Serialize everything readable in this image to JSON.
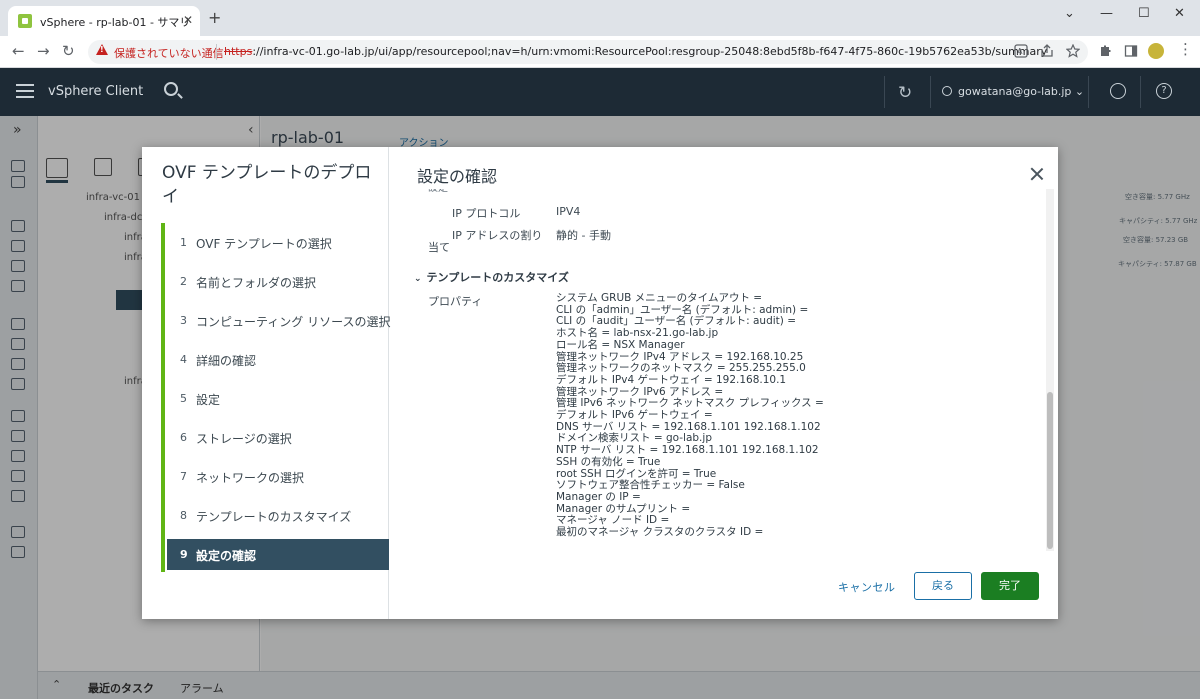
{
  "browser": {
    "tab_title": "vSphere - rp-lab-01 - サマリ",
    "tab_close": "✕",
    "new_tab": "+",
    "insecure_label": "保護されていない通信",
    "url_proto": "https",
    "url_rest": "://infra-vc-01.go-lab.jp/ui/app/resourcepool;nav=h/urn:vmomi:ResourcePool:resgroup-25048:8ebd5f8b-f647-4f75-860c-19b5762ea53b/summary",
    "back": "←",
    "forward": "→",
    "reload": "↻",
    "min": "—",
    "max": "☐",
    "close": "✕",
    "caret": "⌄"
  },
  "vsphere": {
    "brand": "vSphere Client",
    "user": "gowatana@go-lab.jp",
    "user_caret": "⌄",
    "help": "?",
    "refresh": "↻",
    "page_title": "rp-lab-01",
    "actions": "アクション",
    "expand": "»",
    "collapse": "‹",
    "tree": [
      "infra-vc-01",
      "infra-dc",
      "infra",
      "infra",
      "infra"
    ],
    "capacity": [
      "空き容量: 5.77 GHz",
      "キャパシティ: 5.77 GHz",
      "空き容量: 57.23 GB",
      "キャパシティ: 57.87 GB"
    ],
    "bottom_tabs": [
      "最近のタスク",
      "アラーム"
    ],
    "bottom_chev": "⌃"
  },
  "wizard": {
    "title": "OVF テンプレートのデプロイ",
    "steps": [
      {
        "num": "1",
        "label": "OVF テンプレートの選択"
      },
      {
        "num": "2",
        "label": "名前とフォルダの選択"
      },
      {
        "num": "3",
        "label": "コンピューティング リソースの選択"
      },
      {
        "num": "4",
        "label": "詳細の確認"
      },
      {
        "num": "5",
        "label": "設定"
      },
      {
        "num": "6",
        "label": "ストレージの選択"
      },
      {
        "num": "7",
        "label": "ネットワークの選択"
      },
      {
        "num": "8",
        "label": "テンプレートのカスタマイズ"
      },
      {
        "num": "9",
        "label": "設定の確認"
      }
    ],
    "active_step": 9,
    "heading": "設定の確認",
    "top_cut_label": "設定",
    "ip_protocol_label": "IP プロトコル",
    "ip_protocol_value": "IPV4",
    "ip_alloc_label": "IP アドレスの割り",
    "ip_alloc_label2": "当て",
    "ip_alloc_value": "静的 - 手動",
    "section_customize": "テンプレートのカスタマイズ",
    "section_chev": "⌄",
    "properties_label": "プロパティ",
    "properties": [
      "システム GRUB メニューのタイムアウト =",
      "CLI の「admin」ユーザー名 (デフォルト: admin) =",
      "CLI の「audit」ユーザー名 (デフォルト: audit) =",
      "ホスト名 = lab-nsx-21.go-lab.jp",
      "ロール名 = NSX Manager",
      "管理ネットワーク IPv4 アドレス = 192.168.10.25",
      "管理ネットワークのネットマスク = 255.255.255.0",
      "デフォルト IPv4 ゲートウェイ = 192.168.10.1",
      "管理ネットワーク IPv6 アドレス =",
      "管理 IPv6 ネットワーク ネットマスク プレフィックス =",
      "デフォルト IPv6 ゲートウェイ =",
      "DNS サーバ リスト = 192.168.1.101 192.168.1.102",
      "ドメイン検索リスト = go-lab.jp",
      "NTP サーバ リスト = 192.168.1.101 192.168.1.102",
      "SSH の有効化 = True",
      "root SSH ログインを許可 = True",
      "ソフトウェア整合性チェッカー = False",
      "Manager の IP =",
      "Manager のサムプリント =",
      "マネージャ ノード ID =",
      "最初のマネージャ クラスタのクラスタ ID ="
    ],
    "cancel": "キャンセル",
    "back": "戻る",
    "finish": "完了"
  }
}
